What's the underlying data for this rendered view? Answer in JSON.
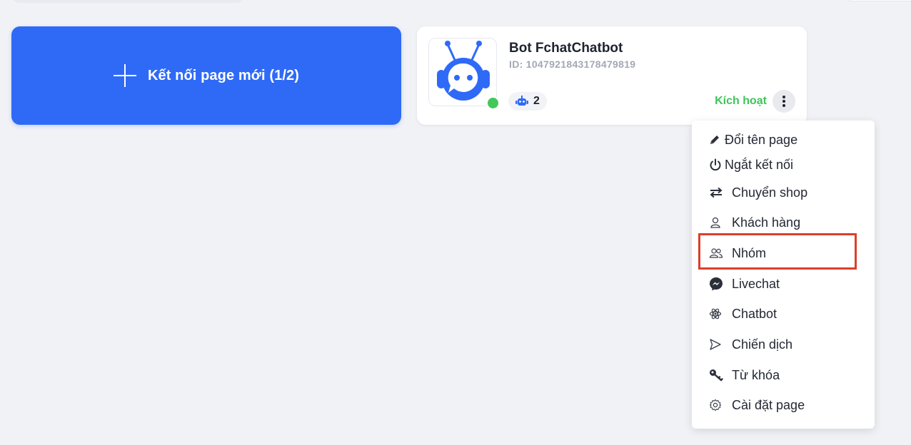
{
  "connect": {
    "label": "Kết nối page mới (1/2)"
  },
  "page_card": {
    "name": "Bot FchatChatbot",
    "id_text": "ID: 1047921843178479819",
    "bot_count": "2",
    "status": "active",
    "activate_label": "Kích hoạt"
  },
  "menu": {
    "items": [
      {
        "label": "Đổi tên page",
        "icon": "pencil-icon"
      },
      {
        "label": "Ngắt kết nối",
        "icon": "power-icon"
      },
      {
        "label": "Chuyển shop",
        "icon": "swap-arrows-icon"
      },
      {
        "label": "Khách hàng",
        "icon": "user-icon"
      },
      {
        "label": "Nhóm",
        "icon": "users-icon",
        "highlighted": true
      },
      {
        "label": "Livechat",
        "icon": "messenger-icon"
      },
      {
        "label": "Chatbot",
        "icon": "atom-icon"
      },
      {
        "label": "Chiến dịch",
        "icon": "send-icon"
      },
      {
        "label": "Từ khóa",
        "icon": "key-icon"
      },
      {
        "label": "Cài đặt page",
        "icon": "settings-icon"
      }
    ]
  },
  "colors": {
    "primary": "#2f6af7",
    "success": "#42c759",
    "highlight": "#d9402b",
    "background": "#f1f2f6"
  }
}
